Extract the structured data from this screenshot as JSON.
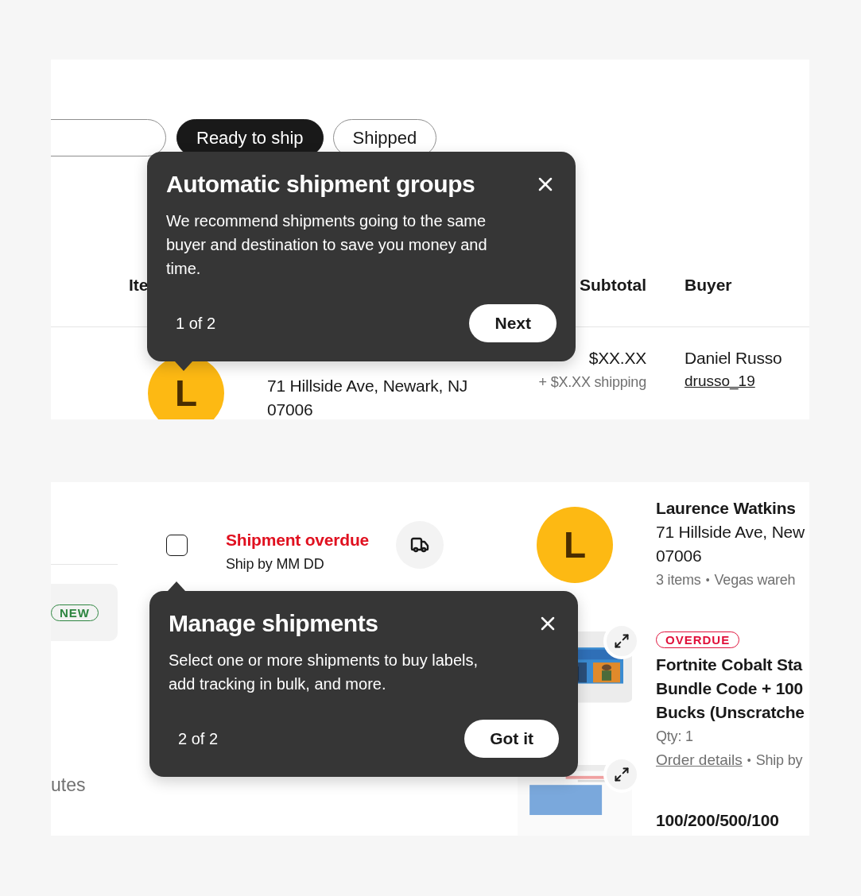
{
  "orders_table": {
    "filters": [
      {
        "kind": "field"
      },
      {
        "kind": "pill",
        "label": "Ready to ship",
        "selected": true
      },
      {
        "kind": "pill",
        "label": "Shipped",
        "selected": false
      }
    ],
    "columns": [
      "Ite",
      "Subtotal",
      "Buyer"
    ],
    "row": {
      "avatar": "L",
      "address": [
        "71 Hillside Ave, Newark, NJ",
        "07006"
      ],
      "subtotal": "$XX.XX",
      "shipping": "+ $X.XX shipping",
      "buyer_name": "Daniel Russo",
      "buyer_id": "drusso_19"
    },
    "tooltip": {
      "title": "Automatic shipment groups",
      "body": "We recommend shipments going to the same buyer and destination to save you money and time.",
      "step": "1 of 2",
      "button": "Next"
    }
  },
  "shipment_list": {
    "sidebar": {
      "badge": "NEW",
      "text": "utes"
    },
    "shipment": {
      "checked": false,
      "status": "Shipment overdue",
      "ship_by": "Ship by MM DD",
      "avatar": "L",
      "buyer": "Laurence Watkins",
      "address": [
        "71 Hillside Ave, New",
        "07006"
      ],
      "meta": [
        "3 items",
        "Vegas wareh"
      ],
      "separator": "•"
    },
    "items": [
      {
        "badge": "OVERDUE",
        "title_lines": [
          "Fortnite Cobalt Sta",
          "Bundle Code + 100",
          "Bucks (Unscratche"
        ],
        "qty": "Qty: 1",
        "link": "Order details",
        "separator": "•",
        "ship_by": "Ship by"
      },
      {
        "title_lines": [
          "100/200/500/100"
        ]
      }
    ],
    "tooltip": {
      "title": "Manage shipments",
      "body": "Select one or more shipments to buy labels, add tracking in bulk, and more.",
      "step": "2 of 2",
      "button": "Got it"
    }
  }
}
